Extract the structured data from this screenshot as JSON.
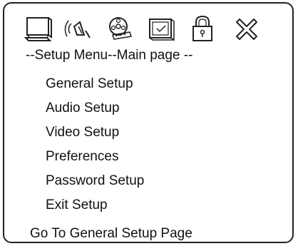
{
  "icons": [
    {
      "name": "tv-monitor-icon"
    },
    {
      "name": "speaker-audio-icon"
    },
    {
      "name": "video-reel-icon"
    },
    {
      "name": "preferences-check-icon"
    },
    {
      "name": "lock-icon"
    },
    {
      "name": "exit-x-icon"
    }
  ],
  "header": {
    "title": "--Setup Menu--Main page --"
  },
  "menu": {
    "items": [
      {
        "label": "General Setup",
        "selected": true
      },
      {
        "label": "Audio Setup"
      },
      {
        "label": "Video Setup"
      },
      {
        "label": "Preferences"
      },
      {
        "label": "Password Setup"
      },
      {
        "label": "Exit Setup"
      }
    ]
  },
  "status": {
    "text": "Go To General Setup Page"
  },
  "colors": {
    "selected_bg": "#d0d0d0",
    "border": "#222222"
  }
}
